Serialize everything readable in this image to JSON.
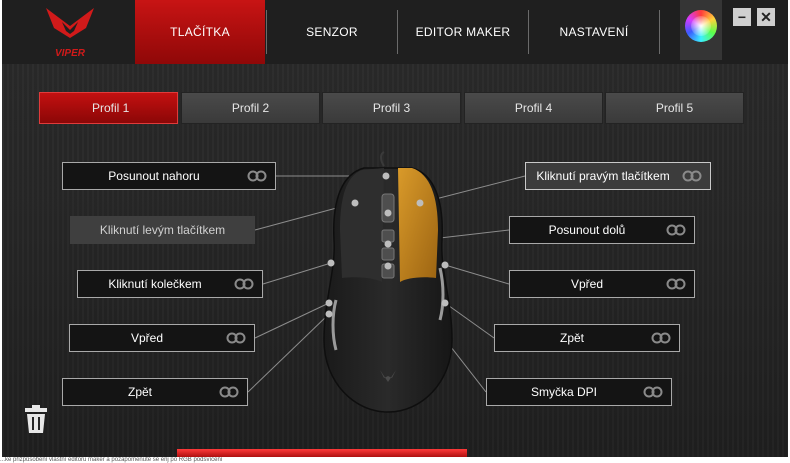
{
  "app": {
    "brand": "VIPER"
  },
  "nav": {
    "tabs": [
      {
        "label": "TLAČÍTKA",
        "active": true
      },
      {
        "label": "SENZOR",
        "active": false
      },
      {
        "label": "EDITOR MAKER",
        "active": false
      },
      {
        "label": "NASTAVENÍ",
        "active": false
      }
    ]
  },
  "window": {
    "minimize_label": "−",
    "close_label": "✕"
  },
  "profiles": [
    {
      "label": "Profil 1",
      "active": true
    },
    {
      "label": "Profil 2",
      "active": false
    },
    {
      "label": "Profil 3",
      "active": false
    },
    {
      "label": "Profil 4",
      "active": false
    },
    {
      "label": "Profil 5",
      "active": false
    }
  ],
  "mappings": {
    "left": [
      {
        "label": "Posunout nahoru"
      },
      {
        "label": "Kliknutí levým tlačítkem"
      },
      {
        "label": "Kliknutí kolečkem"
      },
      {
        "label": "Vpřed"
      },
      {
        "label": "Zpět"
      }
    ],
    "right": [
      {
        "label": "Kliknutí pravým tlačítkem"
      },
      {
        "label": "Posunout dolů"
      },
      {
        "label": "Vpřed"
      },
      {
        "label": "Zpět"
      },
      {
        "label": "Smyčka DPI"
      }
    ]
  },
  "icons": {
    "logo": "viper-logo",
    "link": "link-icon",
    "color": "color-wheel-icon",
    "trash": "trash-icon"
  },
  "colors": {
    "accent": "#c31010",
    "highlight": "#c8861b",
    "background": "#262626"
  },
  "footer": {
    "text": "...ke přizpůsobení vlastní editoru maker a pozapomenute se enj po RGB podsvícení"
  }
}
